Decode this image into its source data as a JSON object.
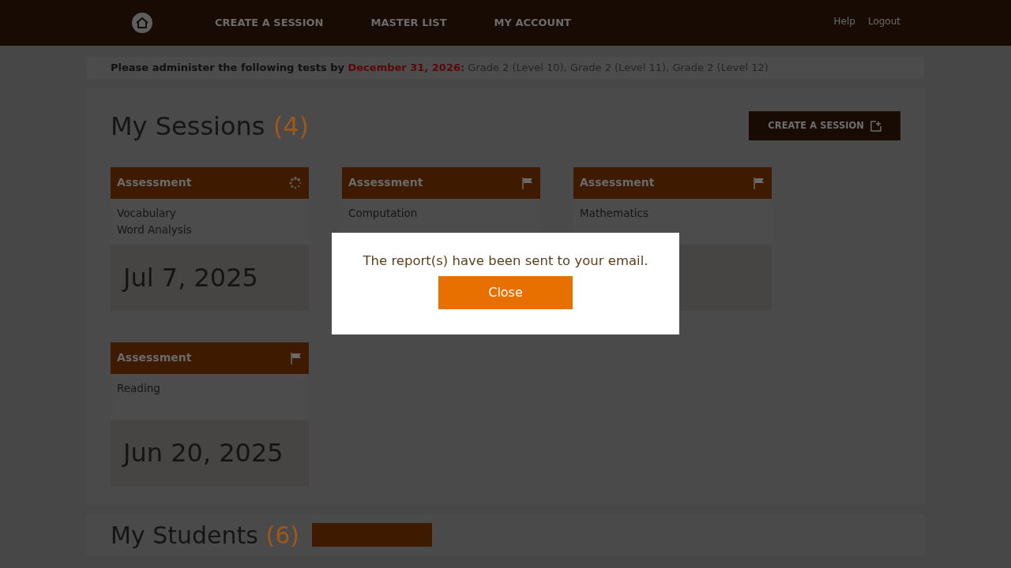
{
  "navbar": {
    "links": [
      {
        "label": "CREATE A SESSION"
      },
      {
        "label": "MASTER LIST"
      },
      {
        "label": "MY ACCOUNT"
      }
    ],
    "right_links": [
      {
        "label": "Help"
      },
      {
        "label": "Logout"
      }
    ]
  },
  "notice": {
    "text": "Please administer the following tests by",
    "deadline": "December 31, 2026:",
    "tests": "Grade 2 (Level 10), Grade 2 (Level 11), Grade 2 (Level 12)"
  },
  "sessions": {
    "title": "My Sessions",
    "count": "(4)",
    "create_button": "CREATE A SESSION",
    "cards": [
      {
        "header": "Assessment",
        "flagged": false,
        "subjects": [
          "Vocabulary",
          "Word Analysis"
        ],
        "date": "Jul 7, 2025"
      },
      {
        "header": "Assessment",
        "flagged": true,
        "subjects": [
          "Computation"
        ]
      },
      {
        "header": "Assessment",
        "flagged": true,
        "subjects": [
          "Mathematics"
        ]
      },
      {
        "header": "Assessment",
        "flagged": true,
        "subjects": [
          "Reading"
        ],
        "date": "Jun 20, 2025"
      }
    ]
  },
  "students": {
    "title": "My Students",
    "count": "(6)"
  },
  "modal": {
    "message": "The report(s) have been sent to your email.",
    "button": "Close"
  }
}
